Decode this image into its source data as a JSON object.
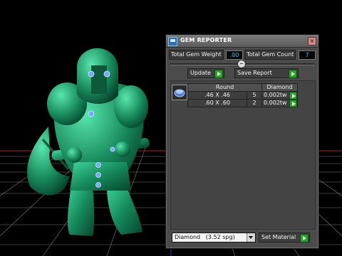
{
  "panel": {
    "title": "GEM REPORTER",
    "close_symbol": "×",
    "total_weight_label": "Total Gem Weight",
    "total_weight_value": ".00",
    "total_count_label": "Total Gem Count",
    "total_count_value": "7",
    "update_label": "Update",
    "save_report_label": "Save Report",
    "table": {
      "headers": [
        "Round",
        "Diamond"
      ],
      "rows": [
        {
          "size": ".46 X .46",
          "count": "5",
          "weight": "0.002tw"
        },
        {
          "size": ".60 X .60",
          "count": "2",
          "weight": "0.002tw"
        }
      ]
    },
    "material_select": {
      "value": "Diamond",
      "detail": "(3.52 spg)"
    },
    "set_material_label": "Set Material"
  },
  "colors": {
    "figure": "#1f9a6a",
    "gem": "#7aa8ff",
    "value_text": "#2ec3ff",
    "go_button": "#2ea02e"
  }
}
